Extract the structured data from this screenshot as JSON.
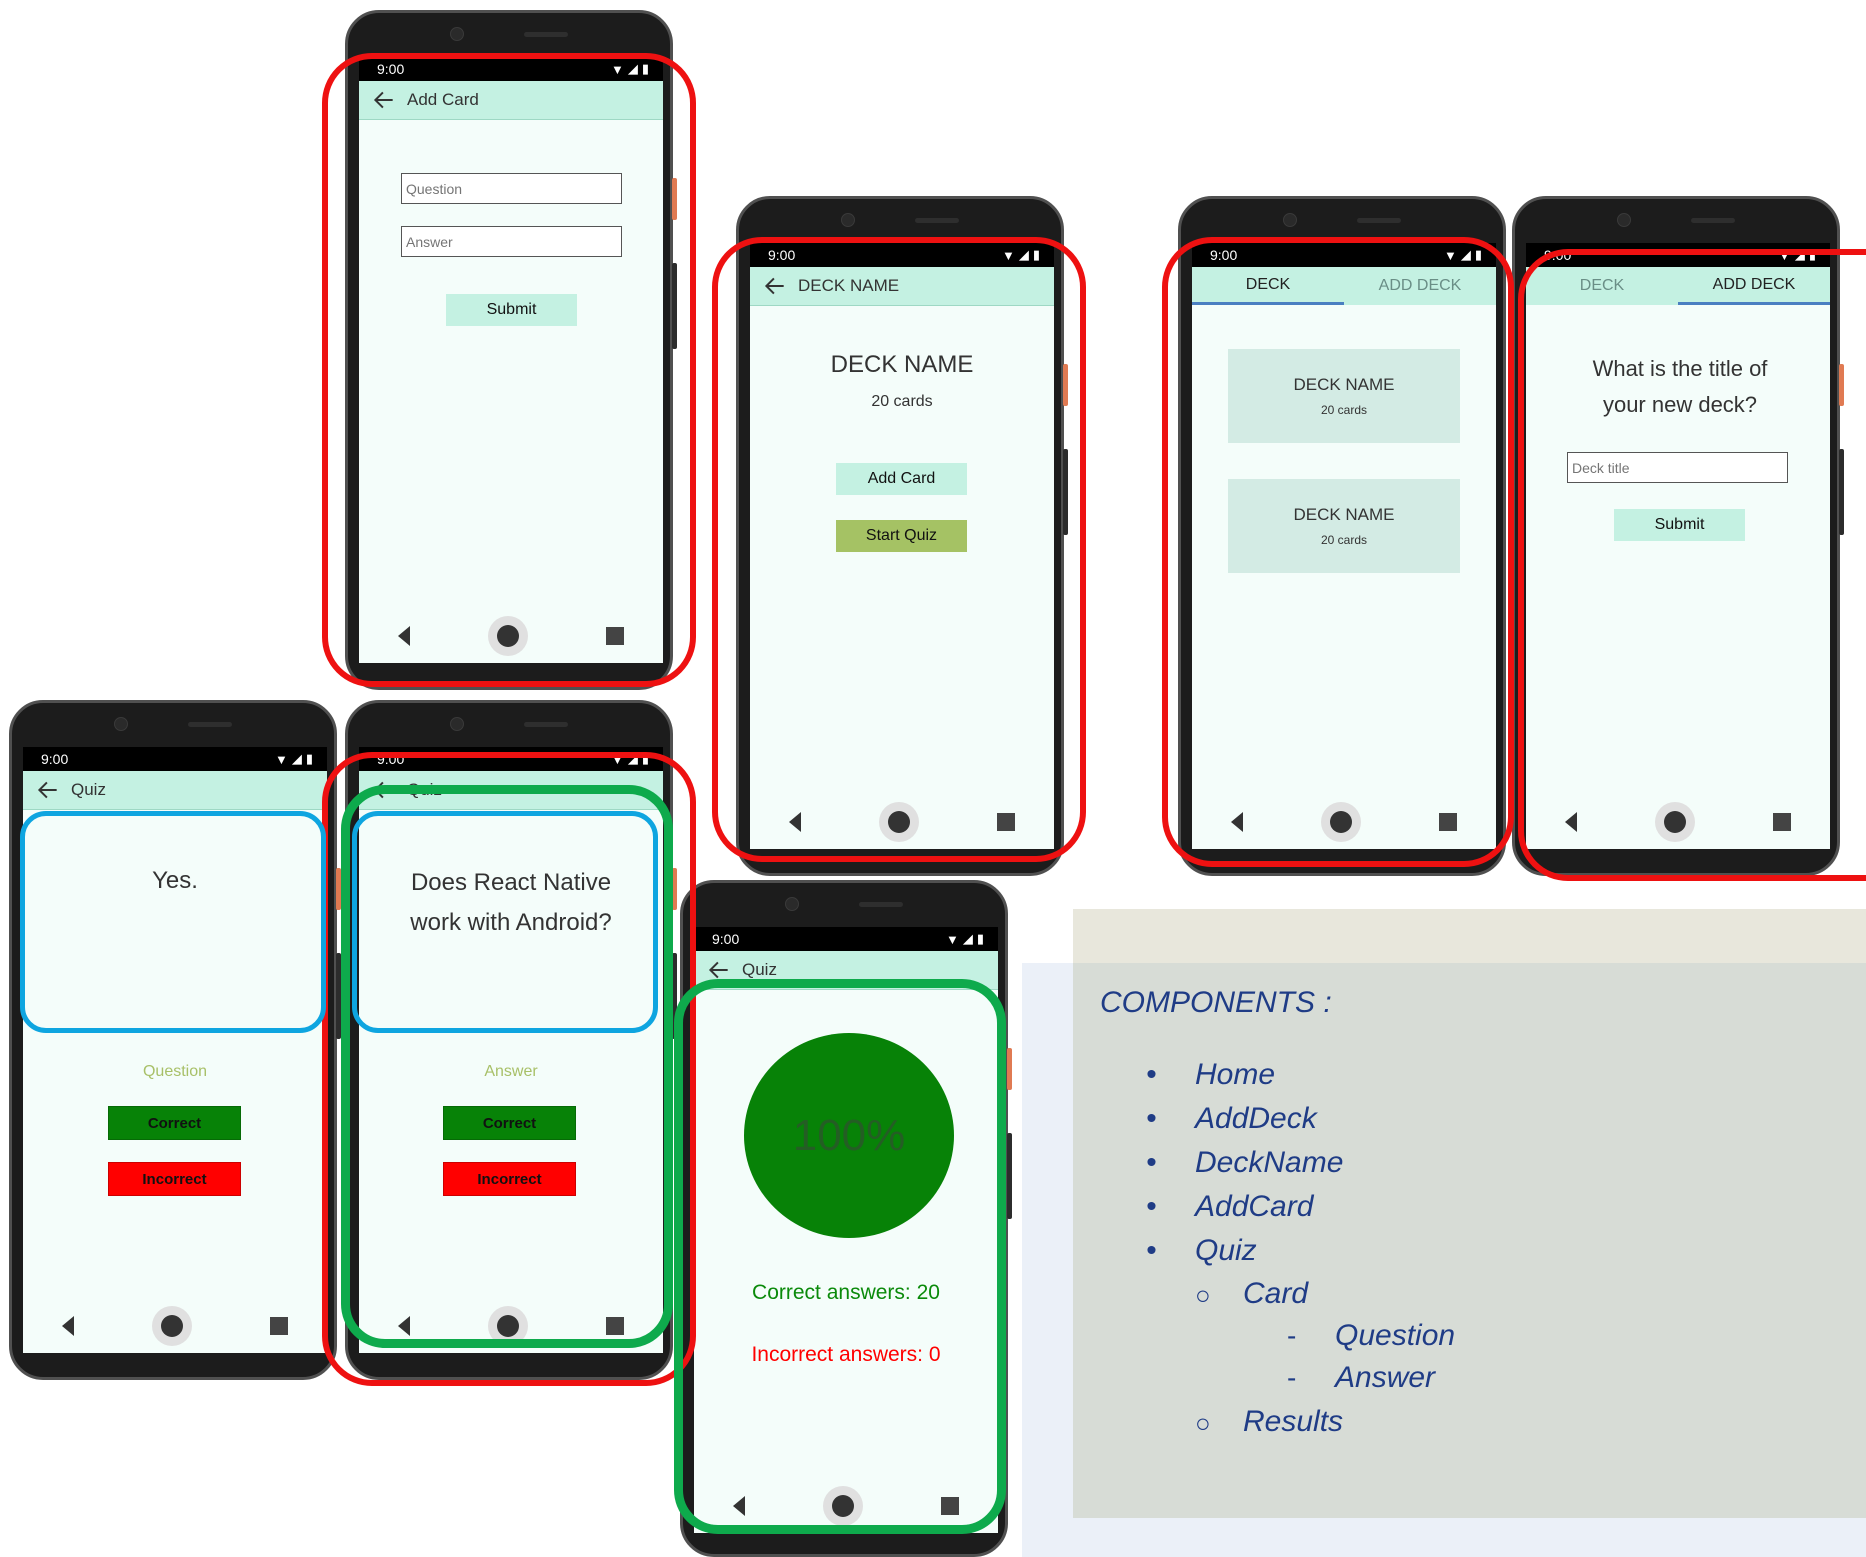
{
  "status_time": "9:00",
  "screens": {
    "add_card": {
      "title": "Add Card",
      "question_placeholder": "Question",
      "answer_placeholder": "Answer",
      "submit_label": "Submit"
    },
    "deck_detail": {
      "title": "DECK NAME",
      "deck_name": "DECK NAME",
      "card_count": "20 cards",
      "add_card_label": "Add Card",
      "start_quiz_label": "Start Quiz"
    },
    "deck_list": {
      "tabs": [
        "DECK",
        "ADD DECK"
      ],
      "decks": [
        {
          "name": "DECK NAME",
          "count": "20 cards"
        },
        {
          "name": "DECK NAME",
          "count": "20 cards"
        }
      ]
    },
    "add_deck": {
      "tabs": [
        "DECK",
        "ADD DECK"
      ],
      "prompt": "What is the title of your new deck?",
      "title_placeholder": "Deck title",
      "submit_label": "Submit"
    },
    "quiz_answer": {
      "title": "Quiz",
      "card_text": "Yes.",
      "toggle_label": "Question",
      "correct_label": "Correct",
      "incorrect_label": "Incorrect"
    },
    "quiz_question": {
      "title": "Quiz",
      "card_text": "Does React Native work with Android?",
      "toggle_label": "Answer",
      "correct_label": "Correct",
      "incorrect_label": "Incorrect"
    },
    "quiz_results": {
      "title": "Quiz",
      "score": "100%",
      "correct_text": "Correct answers: 20",
      "incorrect_text": "Incorrect answers: 0"
    }
  },
  "components": {
    "heading": "COMPONENTS :",
    "items": [
      "Home",
      "AddDeck",
      "DeckName",
      "AddCard",
      "Quiz"
    ],
    "quiz_children": [
      "Card",
      "Results"
    ],
    "card_children": [
      "Question",
      "Answer"
    ]
  },
  "colors": {
    "appbar": "#c4f1e2",
    "screen_bg": "#f4fdfa",
    "correct_green": "#078207",
    "incorrect_red": "#ff0000",
    "highlight_red": "#ee1111",
    "highlight_green": "#0eaa4c",
    "highlight_blue": "#0ea5e0",
    "components_text": "#1f3c86"
  },
  "icons": [
    "back-arrow-icon",
    "wifi-icon",
    "signal-icon",
    "battery-icon",
    "nav-back-icon",
    "nav-home-icon",
    "nav-recent-icon"
  ]
}
